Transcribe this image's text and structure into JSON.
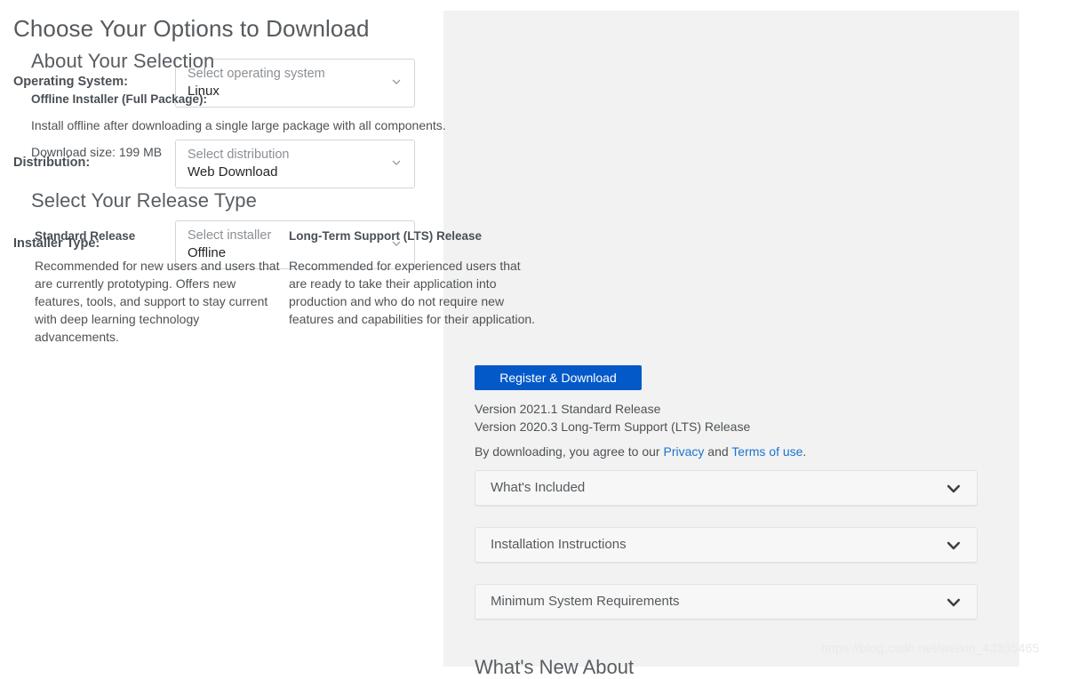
{
  "left": {
    "title": "Choose Your Options to Download",
    "fields": [
      {
        "label": "Operating System:",
        "placeholder": "Select operating system",
        "value": "Linux",
        "caret": "chevron-down-icon"
      },
      {
        "label": "Distribution:",
        "placeholder": "Select distribution",
        "value": "Web Download",
        "caret": "chevron-down-icon"
      },
      {
        "label": "Installer Type:",
        "placeholder": "Select installer",
        "value": "Offline",
        "caret": "chevron-down-icon"
      }
    ]
  },
  "right": {
    "about": {
      "title": "About Your Selection",
      "subtitle": "Offline Installer (Full Package):",
      "description": "Install offline after downloading a single large package with all components.",
      "download_size": "Download size: 199 MB"
    },
    "release": {
      "title": "Select Your Release Type",
      "columns": [
        {
          "heading": "Standard Release",
          "body": "Recommended for new users and users that are currently prototyping. Offers new features, tools, and support to stay current with deep learning technology advancements."
        },
        {
          "heading": "Long-Term Support (LTS) Release",
          "body": "Recommended for experienced users that are ready to take their application into production and who do not require new features and capabilities for their application."
        }
      ]
    },
    "download_button": "Register & Download",
    "versions": [
      "Version 2021.1 Standard Release",
      "Version 2020.3 Long-Term Support (LTS) Release"
    ],
    "terms": {
      "prefix": "By downloading, you agree to our ",
      "privacy_link": "Privacy",
      "middle": " and ",
      "terms_link": "Terms of use",
      "suffix": "."
    },
    "accordions": [
      {
        "label": "What's Included",
        "chevron": "chevron-down-icon"
      },
      {
        "label": "Installation Instructions",
        "chevron": "chevron-down-icon"
      },
      {
        "label": "Minimum System Requirements",
        "chevron": "chevron-down-icon"
      }
    ],
    "bottom_cut_heading": "What's New About"
  },
  "watermark": "https://blog.csdn.net/weixin_43335465",
  "colors": {
    "panel_background": "#f2f2f2",
    "button_blue": "#0459c9",
    "link_blue": "#1b73d0",
    "heading_gray": "#585d61",
    "label_gray": "#4a4f54",
    "body_gray": "#4d5256",
    "placeholder_gray": "#8b9095",
    "border_gray": "#d3d5d8"
  }
}
